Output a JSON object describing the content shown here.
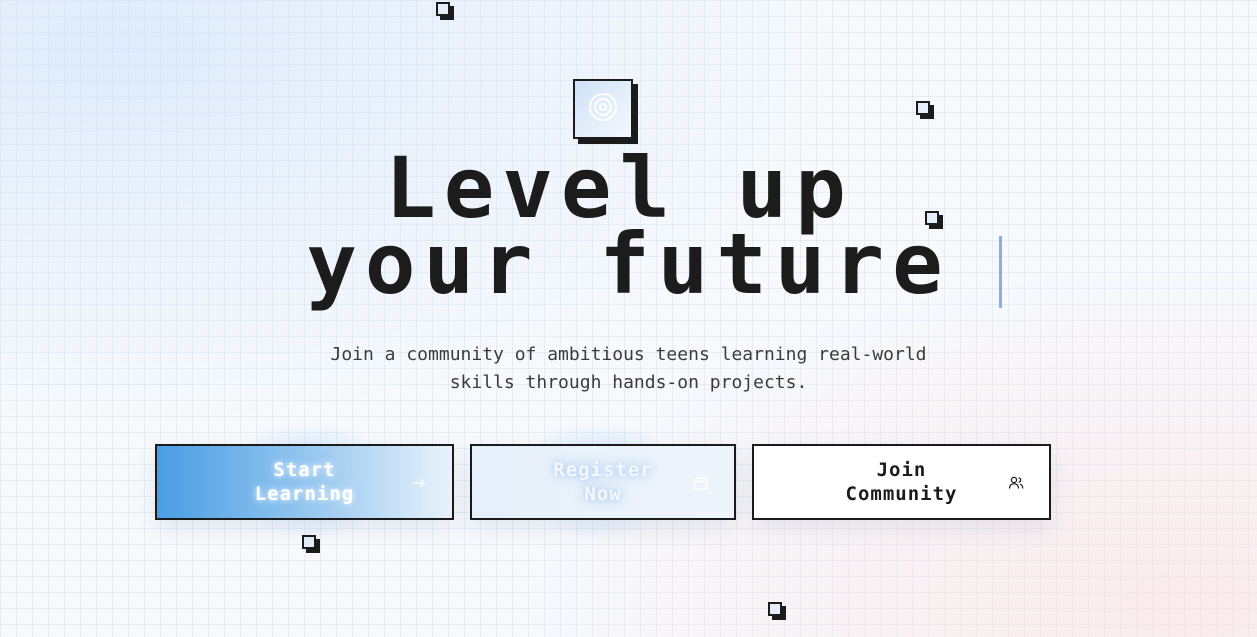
{
  "hero": {
    "headline_line1": "Level up",
    "headline_line2": "your future",
    "subtitle_line1": "Join a community of ambitious teens learning real-world",
    "subtitle_line2": "skills through hands-on projects."
  },
  "buttons": {
    "start_line1": "Start",
    "start_line2": "Learning",
    "start_icon": "arrow-right-icon",
    "register_line1": "Register",
    "register_line2": "Now",
    "register_icon": "calendar-icon",
    "join_line1": "Join",
    "join_line2": "Community",
    "join_icon": "users-icon"
  },
  "badge_icon": "target-icon",
  "colors": {
    "ink": "#1b1b1b",
    "accent_blue": "#4a9de4",
    "cursor_blue": "#7fb3e6",
    "grid": "#dbe4ee"
  }
}
